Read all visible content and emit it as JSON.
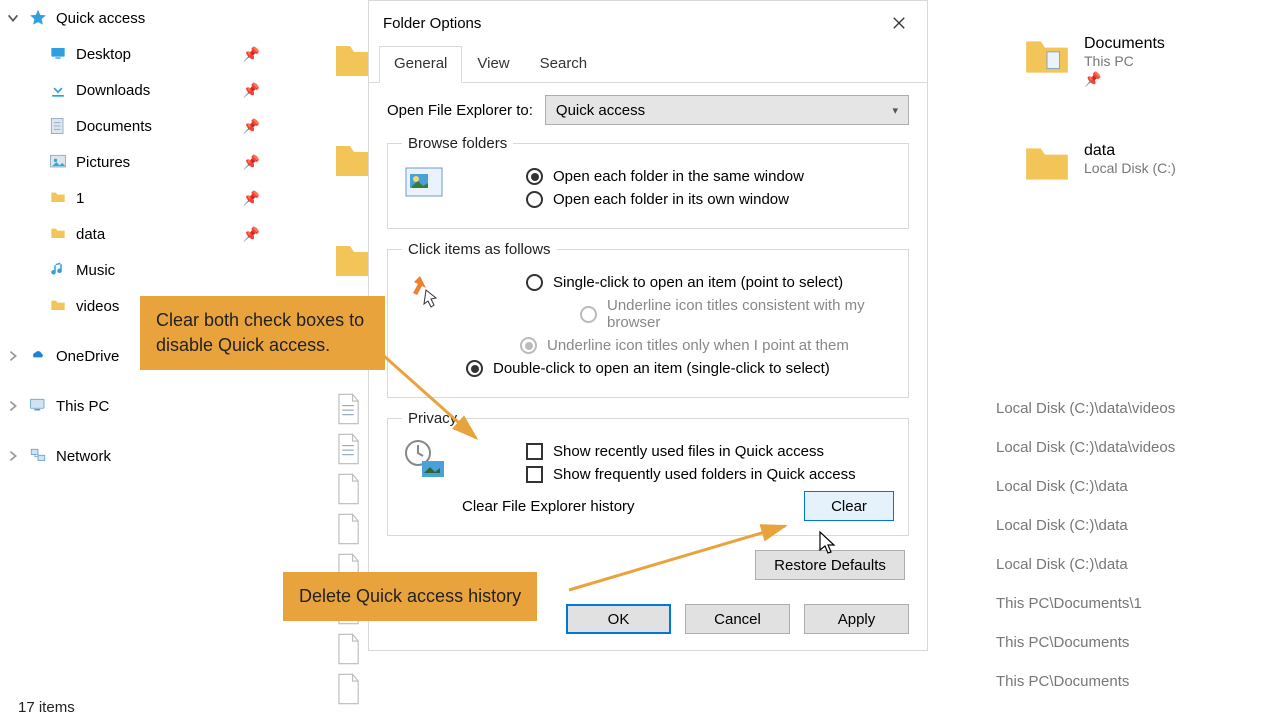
{
  "nav": {
    "quick_access": "Quick access",
    "desktop": "Desktop",
    "downloads": "Downloads",
    "documents": "Documents",
    "pictures": "Pictures",
    "one": "1",
    "data": "data",
    "music": "Music",
    "videos": "videos",
    "onedrive": "OneDrive",
    "thispc": "This PC",
    "network": "Network"
  },
  "status": "17 items",
  "right": {
    "docs_title": "Documents",
    "docs_sub": "This PC",
    "data_title": "data",
    "data_sub": "Local Disk (C:)",
    "paths": [
      "Local Disk (C:)\\data\\videos",
      "Local Disk (C:)\\data\\videos",
      "Local Disk (C:)\\data",
      "Local Disk (C:)\\data",
      "Local Disk (C:)\\data",
      "This PC\\Documents\\1",
      "This PC\\Documents",
      "This PC\\Documents"
    ]
  },
  "dialog": {
    "title": "Folder Options",
    "tabs": {
      "general": "General",
      "view": "View",
      "search": "Search"
    },
    "open_label": "Open File Explorer to:",
    "open_value": "Quick access",
    "browse": {
      "legend": "Browse folders",
      "same": "Open each folder in the same window",
      "own": "Open each folder in its own window"
    },
    "click": {
      "legend": "Click items as follows",
      "single": "Single-click to open an item (point to select)",
      "underline1": "Underline icon titles consistent with my browser",
      "underline2": "Underline icon titles only when I point at them",
      "double": "Double-click to open an item (single-click to select)"
    },
    "privacy": {
      "legend": "Privacy",
      "recent": "Show recently used files in Quick access",
      "frequent": "Show frequently used folders in Quick access",
      "clear_label": "Clear File Explorer history",
      "clear_btn": "Clear"
    },
    "restore": "Restore Defaults",
    "ok": "OK",
    "cancel": "Cancel",
    "apply": "Apply"
  },
  "callouts": {
    "c1": "Clear both check boxes to disable Quick access.",
    "c2": "Delete Quick access history"
  }
}
